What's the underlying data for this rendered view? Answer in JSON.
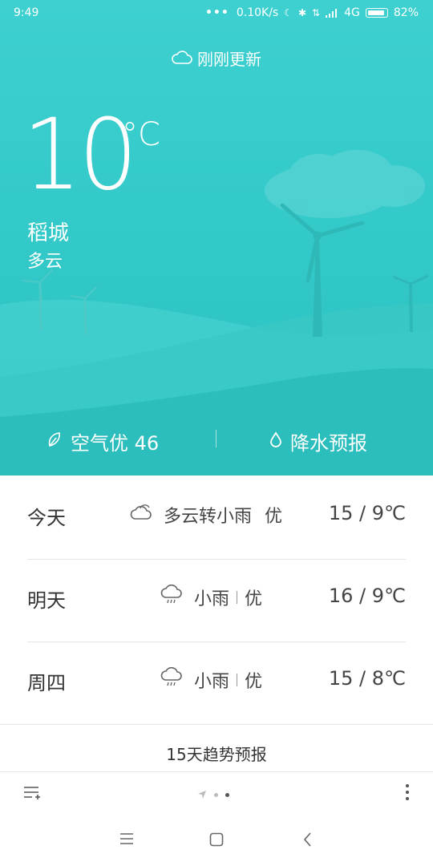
{
  "status_bar": {
    "time": "9:49",
    "network_speed": "0.10K/s",
    "network_type": "4G",
    "battery": "82%",
    "icons": [
      "more-dots-icon",
      "moon-icon",
      "bluetooth-icon",
      "data-arrows-icon",
      "signal-icon",
      "battery-icon"
    ]
  },
  "header": {
    "update_status": "刚刚更新",
    "update_icon": "cloud-icon"
  },
  "current": {
    "temperature": "10",
    "unit": "°C",
    "city": "稻城",
    "condition": "多云"
  },
  "summary": {
    "air_quality": "空气优 46",
    "air_icon": "leaf-icon",
    "precipitation": "降水预报",
    "precipitation_icon": "droplet-icon"
  },
  "forecast": [
    {
      "day": "今天",
      "icon": "cloudy-icon",
      "condition": "多云转小雨",
      "air": "优",
      "temps": "15 / 9℃"
    },
    {
      "day": "明天",
      "icon": "light-rain-icon",
      "condition": "小雨",
      "air": "优",
      "temps": "16 / 9℃"
    },
    {
      "day": "周四",
      "icon": "light-rain-icon",
      "condition": "小雨",
      "air": "优",
      "temps": "15 / 8℃"
    }
  ],
  "trend_link": "15天趋势预报",
  "toolbar": {
    "left_icon": "manage-cities-icon",
    "pager_icons": [
      "location-arrow-icon",
      "page-dot",
      "page-dot-active"
    ],
    "right_icon": "more-vertical-icon"
  },
  "nav_bar": {
    "icons": [
      "menu-icon",
      "home-icon",
      "back-icon"
    ]
  },
  "colors": {
    "hero_top": "#3ed0d0",
    "hero_bottom": "#2bc0c0",
    "text_dark": "#333333"
  }
}
